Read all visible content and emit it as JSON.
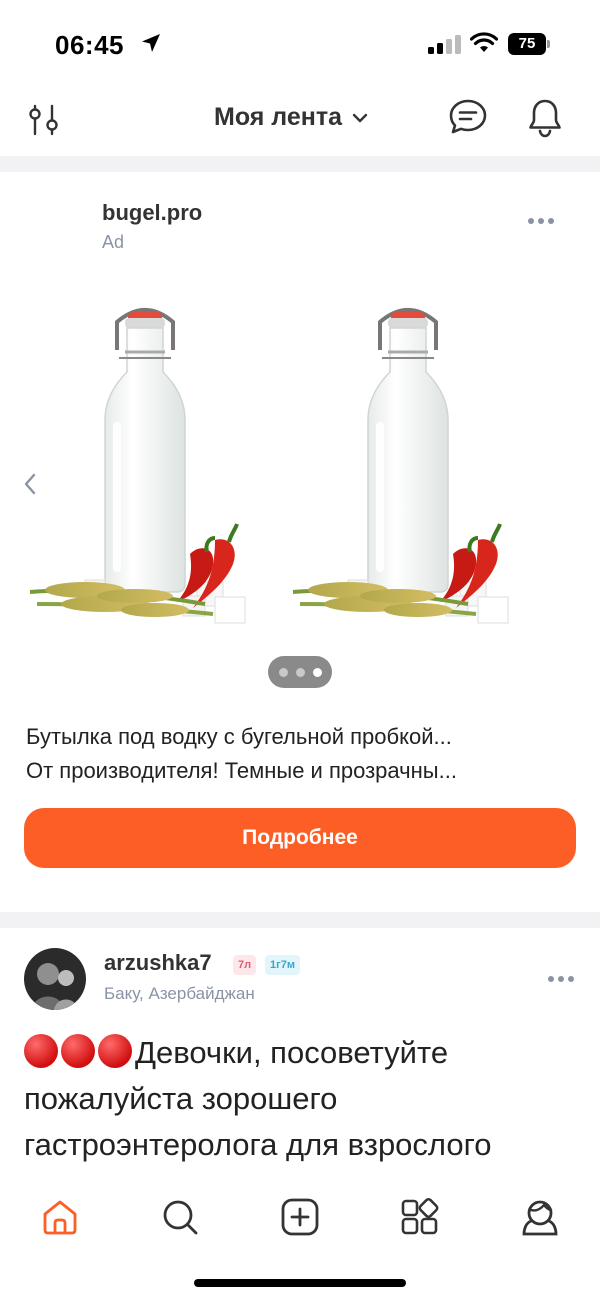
{
  "status_bar": {
    "time": "06:45",
    "battery": "75",
    "icons": [
      "location-arrow-icon",
      "signal-icon",
      "wifi-icon",
      "battery-icon"
    ]
  },
  "top_nav": {
    "title": "Моя лента",
    "icons": [
      "filter-icon",
      "chevron-down-icon",
      "chat-icon",
      "bell-icon"
    ]
  },
  "ad": {
    "advertiser": "bugel.pro",
    "label": "Ad",
    "text_line1": "Бутылка под водку с бугельной пробкой...",
    "text_line2": "От производителя! Темные и прозрачны...",
    "cta_label": "Подробнее",
    "carousel": {
      "slides": 3,
      "active_slide": 3
    }
  },
  "post": {
    "author": "arzushka7",
    "badge_age": "7л",
    "badge_kid": "1г7м",
    "location": "Баку, Азербайджан",
    "text": "Девочки, посоветуйте пожалуйста зорошего гастроэнтеролога для взрослого"
  },
  "bottom_nav": {
    "items": [
      "home-icon",
      "search-icon",
      "add-post-icon",
      "services-icon",
      "profile-icon"
    ],
    "active": "home-icon"
  },
  "colors": {
    "accent": "#fd5e25",
    "muted": "#8a93a6",
    "text": "#222222"
  }
}
